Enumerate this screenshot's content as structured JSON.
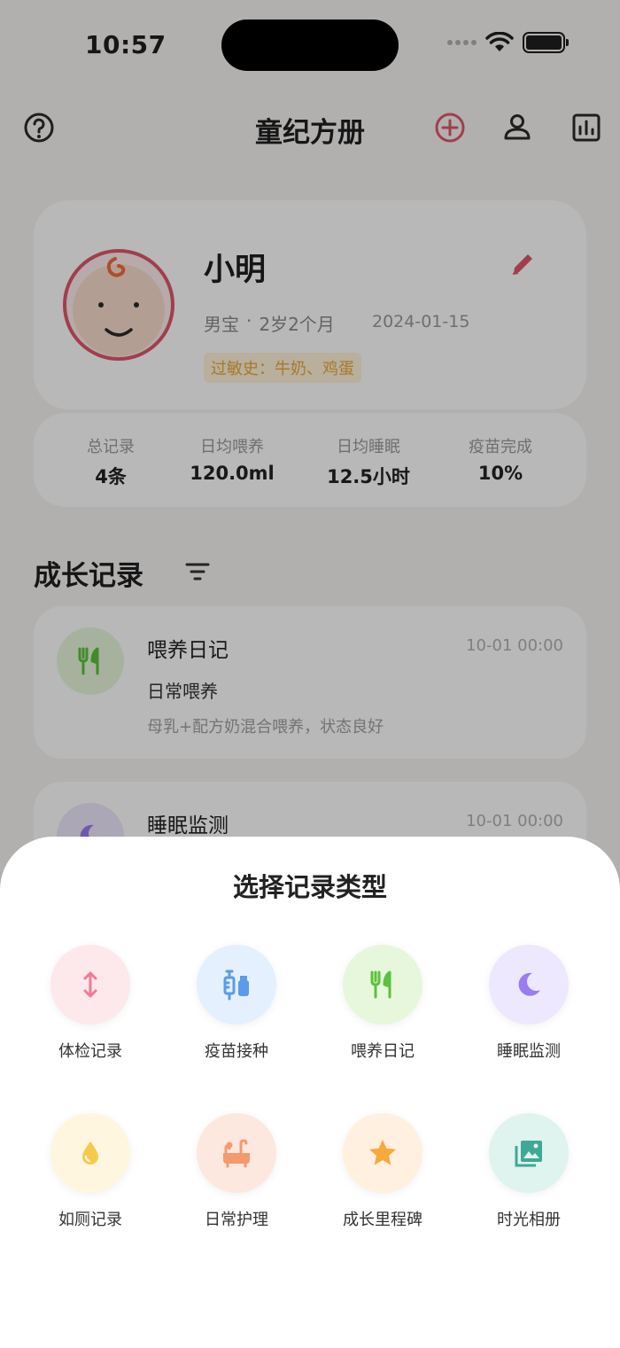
{
  "status_bar": {
    "time": "10:57"
  },
  "header": {
    "title": "童纪方册"
  },
  "profile": {
    "name": "小明",
    "gender": "男宝",
    "separator": "·",
    "age": "2岁2个月",
    "birth_date": "2024-01-15",
    "allergy": "过敏史：牛奶、鸡蛋"
  },
  "stats": [
    {
      "label": "总记录",
      "value": "4条"
    },
    {
      "label": "日均喂养",
      "value": "120.0ml"
    },
    {
      "label": "日均睡眠",
      "value": "12.5小时"
    },
    {
      "label": "疫苗完成",
      "value": "10%"
    }
  ],
  "section": {
    "title": "成长记录"
  },
  "records": [
    {
      "title": "喂养日记",
      "time": "10-01 00:00",
      "subtitle": "日常喂养",
      "desc": "母乳+配方奶混合喂养，状态良好",
      "icon": "fork-knife-icon"
    },
    {
      "title": "睡眠监测",
      "time": "10-01 00:00",
      "icon": "moon-icon"
    }
  ],
  "sheet": {
    "title": "选择记录类型",
    "types": [
      {
        "label": "体检记录",
        "icon": "height-arrow-icon",
        "bg": "#fde8ec",
        "color": "#f27a93"
      },
      {
        "label": "疫苗接种",
        "icon": "vaccine-icon",
        "bg": "#e4f0fd",
        "color": "#5b9be8"
      },
      {
        "label": "喂养日记",
        "icon": "fork-knife-icon",
        "bg": "#e6f7dc",
        "color": "#5cc13c"
      },
      {
        "label": "睡眠监测",
        "icon": "moon-icon",
        "bg": "#ede8fd",
        "color": "#9b7cf0"
      },
      {
        "label": "如厕记录",
        "icon": "droplet-icon",
        "bg": "#fff6e0",
        "color": "#f7c94b"
      },
      {
        "label": "日常护理",
        "icon": "bathtub-icon",
        "bg": "#fde8df",
        "color": "#f59a6e"
      },
      {
        "label": "成长里程碑",
        "icon": "star-icon",
        "bg": "#fff0df",
        "color": "#f7a93c"
      },
      {
        "label": "时光相册",
        "icon": "photo-album-icon",
        "bg": "#dff3ef",
        "color": "#3fa896"
      }
    ]
  },
  "colors": {
    "accent": "#e0566a",
    "allergy_text": "#e8a838",
    "allergy_bg": "#fff3da"
  }
}
